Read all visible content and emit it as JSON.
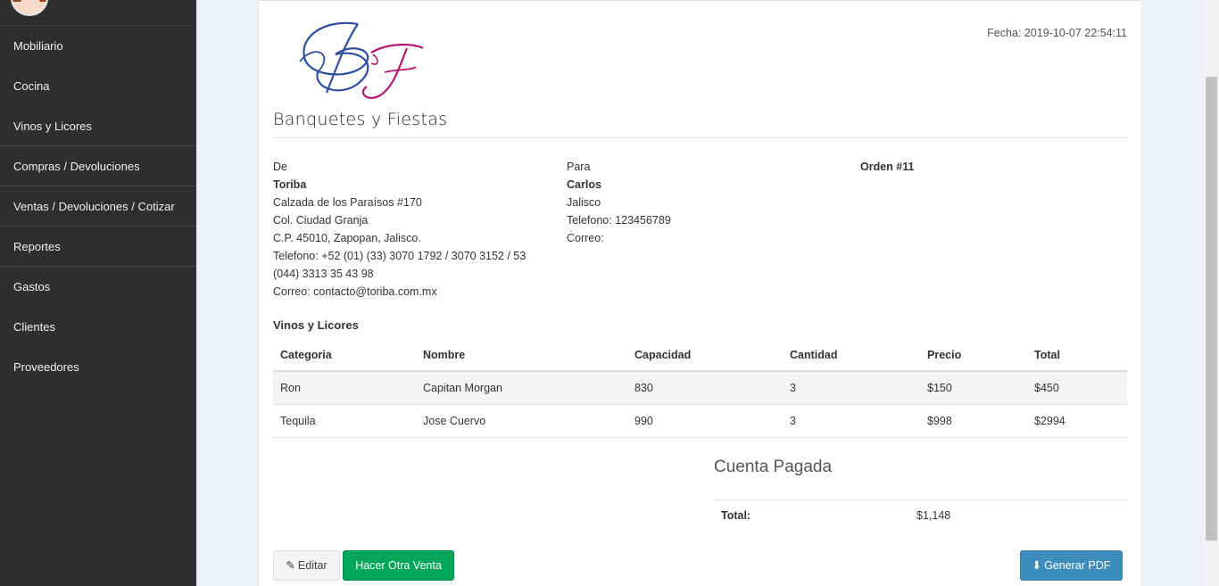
{
  "sidebar": {
    "items": [
      {
        "label": "Mobiliario"
      },
      {
        "label": "Cocina"
      },
      {
        "label": "Vinos y Licores"
      },
      {
        "label": "Compras / Devoluciones"
      },
      {
        "label": "Ventas / Devoluciones / Cotizar"
      },
      {
        "label": "Reportes"
      },
      {
        "label": "Gastos"
      },
      {
        "label": "Clientes"
      },
      {
        "label": "Proveedores"
      }
    ]
  },
  "invoice": {
    "logo_text": "Banquetes y Fiestas",
    "logo_letters": "BF",
    "fecha": "Fecha: 2019-10-07 22:54:11",
    "from": {
      "heading": "De",
      "name": "Toriba",
      "line1": "Calzada de los Paraísos #170",
      "line2": "Col. Ciudad Granja",
      "line3": "C.P. 45010, Zapopan, Jalisco.",
      "line4": "Telefono: +52 (01) (33) 3070 1792 / 3070 3152 / 53",
      "line5": "(044) 3313 35 43 98",
      "line6": "Correo: contacto@toriba.com.mx"
    },
    "to": {
      "heading": "Para",
      "name": "Carlos",
      "line1": "Jalisco",
      "line2": "Telefono: 123456789",
      "line3": "Correo:"
    },
    "order": "Orden #11",
    "section_title": "Vinos y Licores",
    "columns": [
      "Categoria",
      "Nombre",
      "Capacidad",
      "Cantidad",
      "Precio",
      "Total"
    ],
    "rows": [
      [
        "Ron",
        "Capitan Morgan",
        "830",
        "3",
        "$150",
        "$450"
      ],
      [
        "Tequila",
        "Jose Cuervo",
        "990",
        "3",
        "$998",
        "$2994"
      ]
    ],
    "status": "Cuenta Pagada",
    "total_label": "Total:",
    "total_value": "$1,148"
  },
  "buttons": {
    "edit": "Editar",
    "new_sale": "Hacer Otra Venta",
    "pdf": "Generar PDF"
  },
  "colors": {
    "sidebar_bg": "#2e2e2e",
    "success": "#00a65a",
    "primary": "#3c8dbc",
    "logo_blue": "#2f4f9e",
    "logo_magenta": "#b0186e"
  }
}
